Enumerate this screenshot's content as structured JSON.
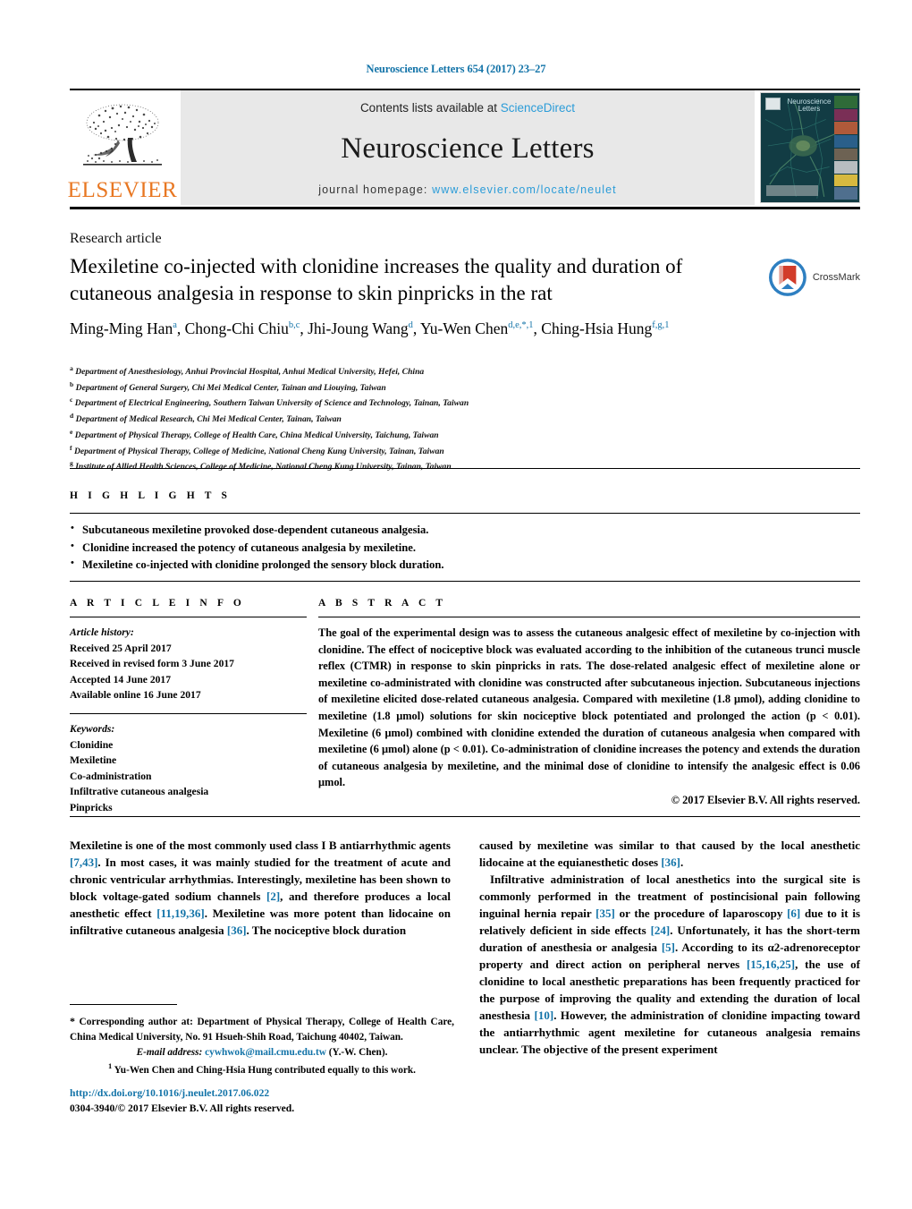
{
  "running_head": "Neuroscience Letters 654 (2017) 23–27",
  "masthead": {
    "publisher_name": "ELSEVIER",
    "contents_prefix": "Contents lists available at ",
    "contents_link": "ScienceDirect",
    "journal_name": "Neuroscience Letters",
    "homepage_prefix": "journal homepage: ",
    "homepage_url": "www.elsevier.com/locate/neulet",
    "cover_title": "Neuroscience Letters"
  },
  "article": {
    "type": "Research article",
    "title": "Mexiletine co-injected with clonidine increases the quality and duration of cutaneous analgesia in response to skin pinpricks in the rat",
    "crossmark_label": "CrossMark",
    "authors_html": "Ming-Ming Han<sup>a</sup>, Chong-Chi Chiu<sup>b,c</sup>, Jhi-Joung Wang<sup>d</sup>, Yu-Wen Chen<sup>d,e,*,1</sup>, Ching-Hsia Hung<sup>f,g,1</sup>",
    "affiliations": [
      {
        "mark": "a",
        "text": "Department of Anesthesiology, Anhui Provincial Hospital, Anhui Medical University, Hefei, China"
      },
      {
        "mark": "b",
        "text": "Department of General Surgery, Chi Mei Medical Center, Tainan and Liouying, Taiwan"
      },
      {
        "mark": "c",
        "text": "Department of Electrical Engineering, Southern Taiwan University of Science and Technology, Tainan, Taiwan"
      },
      {
        "mark": "d",
        "text": "Department of Medical Research, Chi Mei Medical Center, Tainan, Taiwan"
      },
      {
        "mark": "e",
        "text": "Department of Physical Therapy, College of Health Care, China Medical University, Taichung, Taiwan"
      },
      {
        "mark": "f",
        "text": "Department of Physical Therapy, College of Medicine, National Cheng Kung University, Tainan, Taiwan"
      },
      {
        "mark": "g",
        "text": "Institute of Allied Health Sciences, College of Medicine, National Cheng Kung University, Tainan, Taiwan"
      }
    ]
  },
  "highlights": {
    "label": "H I G H L I G H T S",
    "items": [
      "Subcutaneous mexiletine provoked dose-dependent cutaneous analgesia.",
      "Clonidine increased the potency of cutaneous analgesia by mexiletine.",
      "Mexiletine co-injected with clonidine prolonged the sensory block duration."
    ]
  },
  "article_info": {
    "label": "A R T I C L E   I N F O",
    "history_label": "Article history:",
    "history": [
      "Received 25 April 2017",
      "Received in revised form 3 June 2017",
      "Accepted 14 June 2017",
      "Available online 16 June 2017"
    ],
    "keywords_label": "Keywords:",
    "keywords": [
      "Clonidine",
      "Mexiletine",
      "Co-administration",
      "Infiltrative cutaneous analgesia",
      "Pinpricks"
    ]
  },
  "abstract": {
    "label": "A B S T R A C T",
    "text": "The goal of the experimental design was to assess the cutaneous analgesic effect of mexiletine by co-injection with clonidine. The effect of nociceptive block was evaluated according to the inhibition of the cutaneous trunci muscle reflex (CTMR) in response to skin pinpricks in rats. The dose-related analgesic effect of mexiletine alone or mexiletine co-administrated with clonidine was constructed after subcutaneous injection. Subcutaneous injections of mexiletine elicited dose-related cutaneous analgesia. Compared with mexiletine (1.8 μmol), adding clonidine to mexiletine (1.8 μmol) solutions for skin nociceptive block potentiated and prolonged the action (p < 0.01). Mexiletine (6 μmol) combined with clonidine extended the duration of cutaneous analgesia when compared with mexiletine (6 μmol) alone (p < 0.01). Co-administration of clonidine increases the potency and extends the duration of cutaneous analgesia by mexiletine, and the minimal dose of clonidine to intensify the analgesic effect is 0.06 μmol.",
    "copyright": "© 2017 Elsevier B.V. All rights reserved."
  },
  "body": {
    "left_paragraph_html": "Mexiletine is one of the most commonly used class I B antiarrhythmic agents <span class=\"ref\">[7,43]</span>. In most cases, it was mainly studied for the treatment of acute and chronic ventricular arrhythmias. Interestingly, mexiletine has been shown to block voltage-gated sodium channels <span class=\"ref\">[2]</span>, and therefore produces a local anesthetic effect <span class=\"ref\">[11,19,36]</span>. Mexiletine was more potent than lidocaine on infiltrative cutaneous analgesia <span class=\"ref\">[36]</span>. The nociceptive block duration",
    "right_paragraph1_html": "caused by mexiletine was similar to that caused by the local anesthetic lidocaine at the equianesthetic doses <span class=\"ref\">[36]</span>.",
    "right_paragraph2_html": "Infiltrative administration of local anesthetics into the surgical site is commonly performed in the treatment of postincisional pain following inguinal hernia repair <span class=\"ref\">[35]</span> or the procedure of laparoscopy <span class=\"ref\">[6]</span> due to it is relatively deficient in side effects <span class=\"ref\">[24]</span>. Unfortunately, it has the short-term duration of anesthesia or analgesia <span class=\"ref\">[5]</span>. According to its α2-adrenoreceptor property and direct action on peripheral nerves <span class=\"ref\">[15,16,25]</span>, the use of clonidine to local anesthetic preparations has been frequently practiced for the purpose of improving the quality and extending the duration of local anesthesia <span class=\"ref\">[10]</span>. However, the administration of clonidine impacting toward the antiarrhythmic agent mexiletine for cutaneous analgesia remains unclear. The objective of the present experiment"
  },
  "footnotes": {
    "corresponding_html": "<span class=\"star\">*</span> Corresponding author at: Department of Physical Therapy, College of Health Care, China Medical University, No. 91 Hsueh-Shih Road, Taichung 40402, Taiwan.",
    "email_label": "E-mail address:",
    "email": "cywhwok@mail.cmu.edu.tw",
    "email_suffix": "(Y.-W. Chen).",
    "equal_contrib_html": "<sup class=\"fn\">1</sup> Yu-Wen Chen and Ching-Hsia Hung contributed equally to this work."
  },
  "footer": {
    "doi": "http://dx.doi.org/10.1016/j.neulet.2017.06.022",
    "issn_copyright": "0304-3940/© 2017 Elsevier B.V. All rights reserved."
  },
  "colors": {
    "link_blue": "#1273a8",
    "sciencedirect_blue": "#2b9cd8",
    "elsevier_orange": "#e87722",
    "band_gray": "#e8e8e8"
  }
}
